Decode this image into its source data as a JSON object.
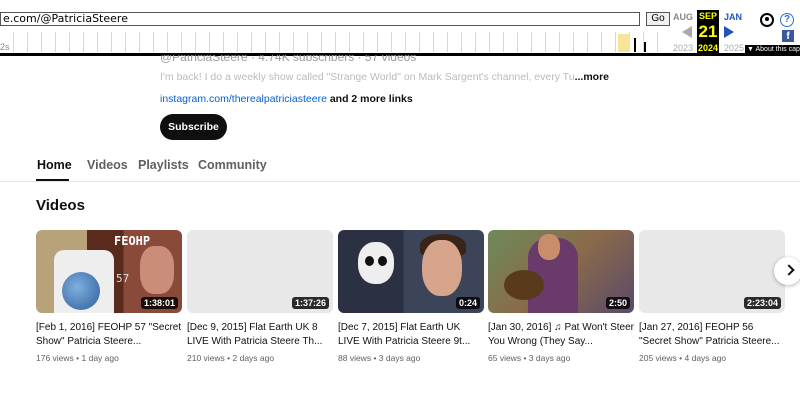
{
  "wayback": {
    "url": "e.com/@PatriciaSteere",
    "go_label": "Go",
    "left_tick": "2s",
    "prev_month": "AUG",
    "prev_year": "2023",
    "cur_month": "SEP",
    "cur_day": "21",
    "cur_year": "2024",
    "next_month": "JAN",
    "next_year": "2025",
    "about_label": "▼ About this capture"
  },
  "channel": {
    "handle": "@PatriciaSteere · 4.74K subscribers · 57 videos",
    "description": "I'm back!  I do a weekly show called \"Strange World\" on Mark Sargent's channel, every Tu",
    "more_label": "...more",
    "link_text": "instagram.com/therealpatriciasteere",
    "more_links": " and 2 more links",
    "subscribe_label": "Subscribe"
  },
  "tabs": [
    {
      "label": "Home"
    },
    {
      "label": "Videos"
    },
    {
      "label": "Playlists"
    },
    {
      "label": "Community"
    }
  ],
  "section_title": "Videos",
  "videos": [
    {
      "title": "[Feb 1, 2016] FEOHP 57 \"Secret Show\" Patricia Steere...",
      "duration": "1:38:01",
      "views": "176 views",
      "age": "1 day ago",
      "overlay_label": "FEOHP",
      "overlay_num": "57"
    },
    {
      "title": "[Dec 9, 2015] Flat Earth UK 8 LIVE With Patricia Steere Th...",
      "duration": "1:37:26",
      "views": "210 views",
      "age": "2 days ago"
    },
    {
      "title": "[Dec 7, 2015] Flat Earth UK LIVE With Patricia Steere 9t...",
      "duration": "0:24",
      "views": "88 views",
      "age": "3 days ago"
    },
    {
      "title": "[Jan 30, 2016] ♫ Pat Won't Steer You Wrong (They Say...",
      "duration": "2:50",
      "views": "65 views",
      "age": "3 days ago"
    },
    {
      "title": "[Jan 27, 2016] FEOHP 56 \"Secret Show\" Patricia Steere...",
      "duration": "2:23:04",
      "views": "205 views",
      "age": "4 days ago"
    }
  ]
}
